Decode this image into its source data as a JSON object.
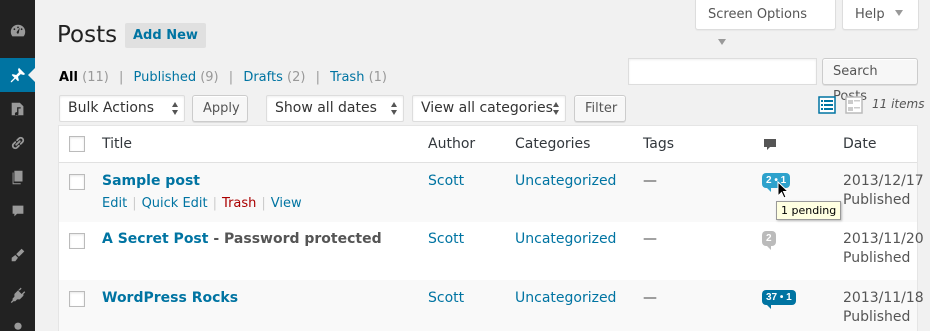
{
  "page": {
    "title": "Posts",
    "add_new": "Add New"
  },
  "screen_options": {
    "screen_options_label": "Screen Options",
    "help_label": "Help"
  },
  "views": {
    "all": {
      "label": "All",
      "count": "(11)"
    },
    "published": {
      "label": "Published",
      "count": "(9)"
    },
    "drafts": {
      "label": "Drafts",
      "count": "(2)"
    },
    "trash": {
      "label": "Trash",
      "count": "(1)"
    },
    "separator": "|"
  },
  "search": {
    "value": "",
    "button": "Search Posts"
  },
  "filters": {
    "bulk_actions": "Bulk Actions",
    "apply": "Apply",
    "dates": "Show all dates",
    "categories": "View all categories",
    "filter": "Filter"
  },
  "items_count": "11 items",
  "table": {
    "columns": {
      "title": "Title",
      "author": "Author",
      "categories": "Categories",
      "tags": "Tags",
      "date": "Date"
    },
    "rows": [
      {
        "title": "Sample post",
        "state": "",
        "author": "Scott",
        "category": "Uncategorized",
        "tags": "—",
        "comments": "2 • 1",
        "date": "2013/12/17",
        "status": "Published",
        "actions": {
          "edit": "Edit",
          "quick_edit": "Quick Edit",
          "trash": "Trash",
          "view": "View",
          "sep": "|"
        }
      },
      {
        "title": "A Secret Post",
        "state": " - Password protected",
        "author": "Scott",
        "category": "Uncategorized",
        "tags": "—",
        "comments": "2",
        "date": "2013/11/20",
        "status": "Published"
      },
      {
        "title": "WordPress Rocks",
        "state": "",
        "author": "Scott",
        "category": "Uncategorized",
        "tags": "—",
        "comments": "37 • 1",
        "date": "2013/11/18",
        "status": "Published"
      }
    ]
  },
  "tooltip": "1 pending",
  "colors": {
    "accent": "#0074a2",
    "menu_bg": "#222222",
    "trash": "#aa0000"
  },
  "icons": [
    "dashboard-icon",
    "pin-icon",
    "media-icon",
    "links-icon",
    "pages-icon",
    "comments-icon",
    "appearance-icon",
    "plugins-icon",
    "comment-bubble-icon",
    "list-view-icon",
    "excerpt-view-icon"
  ]
}
